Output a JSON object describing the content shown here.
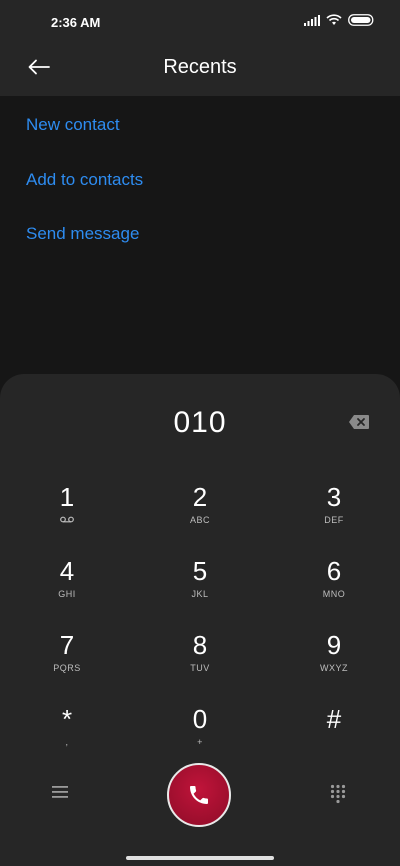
{
  "status": {
    "time": "2:36 AM",
    "battery_icon": "battery-icon",
    "wifi_icon": "wifi-icon",
    "signal_icon": "signal-icon"
  },
  "header": {
    "title": "Recents",
    "back_icon": "arrow-left-icon"
  },
  "actions": [
    {
      "label": "New contact"
    },
    {
      "label": "Add to contacts"
    },
    {
      "label": "Send message"
    }
  ],
  "dialpad": {
    "number": "010",
    "keys": [
      {
        "digit": "1",
        "letters": ""
      },
      {
        "digit": "2",
        "letters": "ABC"
      },
      {
        "digit": "3",
        "letters": "DEF"
      },
      {
        "digit": "4",
        "letters": "GHI"
      },
      {
        "digit": "5",
        "letters": "JKL"
      },
      {
        "digit": "6",
        "letters": "MNO"
      },
      {
        "digit": "7",
        "letters": "PQRS"
      },
      {
        "digit": "8",
        "letters": "TUV"
      },
      {
        "digit": "9",
        "letters": "WXYZ"
      },
      {
        "digit": "*",
        "letters": ","
      },
      {
        "digit": "0",
        "letters": "+"
      },
      {
        "digit": "#",
        "letters": ""
      }
    ]
  },
  "colors": {
    "accent": "#2e8cf0",
    "call": "#b0102f",
    "background": "#161616",
    "surface": "#262626"
  }
}
